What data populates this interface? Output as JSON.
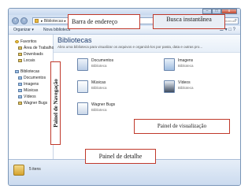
{
  "window": {
    "controls": {
      "minimize": "–",
      "maximize": "□",
      "close": "x"
    }
  },
  "address": {
    "back_icon": "back-arrow",
    "forward_icon": "forward-arrow",
    "path": "▸ Bibliotecas ▸",
    "search_placeholder": "Pesquisar Bibliotecas",
    "search_icon": "magnifier"
  },
  "toolbar": {
    "organize": "Organizar ▾",
    "new_library": "Nova biblioteca",
    "view_icons": "☰ ▾  □  ?"
  },
  "sidebar": {
    "items": [
      {
        "label": "Favoritos",
        "icon": "star"
      },
      {
        "label": "Área de Trabalho",
        "icon": "folder"
      },
      {
        "label": "Downloads",
        "icon": "folder"
      },
      {
        "label": "Locais",
        "icon": "folder"
      },
      {
        "label": "Bibliotecas",
        "icon": "library"
      },
      {
        "label": "Documentos",
        "icon": "folder"
      },
      {
        "label": "Imagens",
        "icon": "folder"
      },
      {
        "label": "Músicas",
        "icon": "folder"
      },
      {
        "label": "Vídeos",
        "icon": "folder"
      },
      {
        "label": "Wagner Bugs",
        "icon": "folder"
      }
    ]
  },
  "content": {
    "title": "Bibliotecas",
    "subtitle": "Abra uma biblioteca para visualizar os arquivos e organizá-los por pasta, data e outras pro...",
    "libraries": [
      {
        "name": "Documentos",
        "type": "Biblioteca",
        "icon": "documents"
      },
      {
        "name": "Imagens",
        "type": "Biblioteca",
        "icon": "pictures"
      },
      {
        "name": "Músicas",
        "type": "Biblioteca",
        "icon": "music"
      },
      {
        "name": "Vídeos",
        "type": "Biblioteca",
        "icon": "videos"
      },
      {
        "name": "Wagner Bugs",
        "type": "Biblioteca",
        "icon": "user"
      }
    ]
  },
  "details": {
    "count": "5 itens"
  },
  "callouts": {
    "address_bar": "Barra de endereço",
    "search": "Busca instantânea",
    "navigation": "Painel de Navegação",
    "preview": "Painel de visualização",
    "details": "Painel de detalhe"
  },
  "colors": {
    "callout_border": "#c0392b",
    "window_frame": "#c9daf0"
  }
}
